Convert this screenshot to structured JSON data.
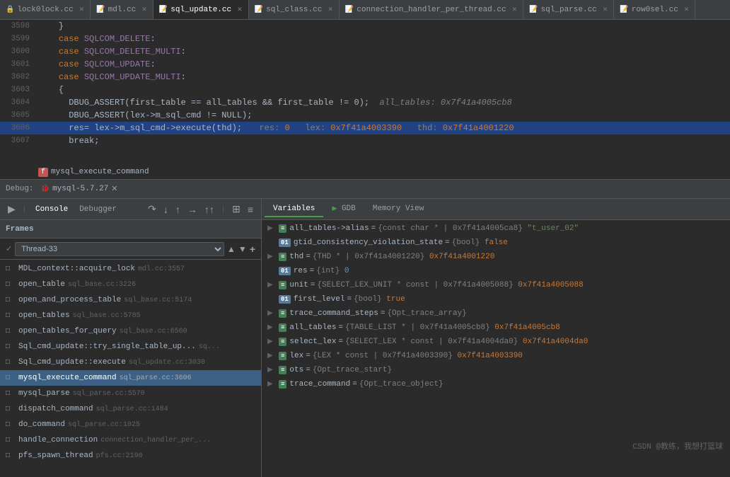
{
  "tabs": [
    {
      "id": "lock0lock",
      "label": "lock0lock.cc",
      "active": false,
      "icon": "📄"
    },
    {
      "id": "mdl",
      "label": "mdl.cc",
      "active": false,
      "icon": "📄"
    },
    {
      "id": "sql_update",
      "label": "sql_update.cc",
      "active": true,
      "icon": "📄"
    },
    {
      "id": "sql_class",
      "label": "sql_class.cc",
      "active": false,
      "icon": "📄"
    },
    {
      "id": "connection_handler",
      "label": "connection_handler_per_thread.cc",
      "active": false,
      "icon": "📄"
    },
    {
      "id": "sql_parse",
      "label": "sql_parse.cc",
      "active": false,
      "icon": "📄"
    },
    {
      "id": "row0sel",
      "label": "row0sel.cc",
      "active": false,
      "icon": "📄"
    }
  ],
  "code_lines": [
    {
      "num": "3598",
      "content": "    }",
      "highlighted": false
    },
    {
      "num": "3599",
      "content": "    case SQLCOM_DELETE:",
      "highlighted": false
    },
    {
      "num": "3600",
      "content": "    case SQLCOM_DELETE_MULTI:",
      "highlighted": false
    },
    {
      "num": "3601",
      "content": "    case SQLCOM_UPDATE:",
      "highlighted": false
    },
    {
      "num": "3602",
      "content": "    case SQLCOM_UPDATE_MULTI:",
      "highlighted": false
    },
    {
      "num": "3603",
      "content": "    {",
      "highlighted": false
    },
    {
      "num": "3604",
      "content": "      DBUG_ASSERT(first_table == all_tables && first_table != 0);",
      "highlighted": false,
      "comment": "all_tables: 0x7f41a4005cb8"
    },
    {
      "num": "3605",
      "content": "      DBUG_ASSERT(lex->m_sql_cmd != NULL);",
      "highlighted": false
    },
    {
      "num": "3606",
      "content": "      res= lex->m_sql_cmd->execute(thd);",
      "highlighted": true,
      "inline": "res: 0   lex: 0x7f41a4003390   thd: 0x7f41a4001220"
    },
    {
      "num": "3607",
      "content": "      break;",
      "highlighted": false
    }
  ],
  "call_tag": "mysql_execute_command",
  "debug_session": "mysql-5.7.27",
  "panel_tabs": {
    "console": "Console",
    "debugger": "Debugger"
  },
  "toolbar_icons": {
    "resume": "▶",
    "pause": "⏸",
    "step_over": "↷",
    "step_into": "↓",
    "step_out": "↑",
    "run_to": "→",
    "settings": "☰",
    "frames_view": "⊞",
    "vars_view": "≡"
  },
  "frames_header": "Frames",
  "thread": {
    "name": "Thread-33",
    "check": "✓"
  },
  "frames": [
    {
      "name": "MDL_context::acquire_lock",
      "loc": "mdl.cc:3557",
      "selected": false,
      "icon": "□"
    },
    {
      "name": "open_table",
      "loc": "sql_base.cc:3226",
      "selected": false,
      "icon": "□"
    },
    {
      "name": "open_and_process_table",
      "loc": "sql_base.cc:5174",
      "selected": false,
      "icon": "□"
    },
    {
      "name": "open_tables",
      "loc": "sql_base.cc:5785",
      "selected": false,
      "icon": "□"
    },
    {
      "name": "open_tables_for_query",
      "loc": "sql_base.cc:6560",
      "selected": false,
      "icon": "□"
    },
    {
      "name": "Sql_cmd_update::try_single_table_update",
      "loc": "sq...",
      "selected": false,
      "icon": "□"
    },
    {
      "name": "Sql_cmd_update::execute",
      "loc": "sql_update.cc:3030",
      "selected": false,
      "icon": "□"
    },
    {
      "name": "mysql_execute_command",
      "loc": "sql_parse.cc:3606",
      "selected": true,
      "icon": "□"
    },
    {
      "name": "mysql_parse",
      "loc": "sql_parse.cc:5570",
      "selected": false,
      "icon": "□"
    },
    {
      "name": "dispatch_command",
      "loc": "sql_parse.cc:1484",
      "selected": false,
      "icon": "□"
    },
    {
      "name": "do_command",
      "loc": "sql_parse.cc:1025",
      "selected": false,
      "icon": "□"
    },
    {
      "name": "handle_connection",
      "loc": "connection_handler_per_...",
      "selected": false,
      "icon": "□"
    },
    {
      "name": "pfs_spawn_thread",
      "loc": "pfs.cc:2190",
      "selected": false,
      "icon": "□"
    }
  ],
  "vars_tabs": [
    {
      "label": "Variables",
      "active": true
    },
    {
      "label": "GDB",
      "icon": "▶",
      "active": false
    },
    {
      "label": "Memory View",
      "active": false
    }
  ],
  "variables": [
    {
      "expand": "▶",
      "type": "e",
      "name": "all_tables->alias",
      "eq": "=",
      "val": "{const char * | 0x7f41a4005ca8}",
      "strval": "\"t_user_02\""
    },
    {
      "expand": " ",
      "type": "01",
      "name": "gtid_consistency_violation_state",
      "eq": "=",
      "val": "{bool}",
      "boolval": "false"
    },
    {
      "expand": "▶",
      "type": "e",
      "name": "thd",
      "eq": "=",
      "val": "{THD * | 0x7f41a4001220}",
      "addrval": "0x7f41a4001220"
    },
    {
      "expand": " ",
      "type": "01",
      "name": "res",
      "eq": "=",
      "val": "{int}",
      "numval": "0"
    },
    {
      "expand": "▶",
      "type": "e",
      "name": "unit",
      "eq": "=",
      "val": "{SELECT_LEX_UNIT * const | 0x7f41a4005088}",
      "addrval": "0x7f41a4005088"
    },
    {
      "expand": " ",
      "type": "01",
      "name": "first_level",
      "eq": "=",
      "val": "{bool}",
      "boolval": "true"
    },
    {
      "expand": "▶",
      "type": "e",
      "name": "trace_command_steps",
      "eq": "=",
      "val": "{Opt_trace_array}"
    },
    {
      "expand": "▶",
      "type": "e",
      "name": "all_tables",
      "eq": "=",
      "val": "{TABLE_LIST * | 0x7f41a4005cb8}",
      "addrval": "0x7f41a4005cb8"
    },
    {
      "expand": "▶",
      "type": "e",
      "name": "select_lex",
      "eq": "=",
      "val": "{SELECT_LEX * const | 0x7f41a4004da0}",
      "addrval": "0x7f41a4004da0"
    },
    {
      "expand": "▶",
      "type": "e",
      "name": "lex",
      "eq": "=",
      "val": "{LEX * const | 0x7f41a4003390}",
      "addrval": "0x7f41a4003390"
    },
    {
      "expand": "▶",
      "type": "e",
      "name": "ots",
      "eq": "=",
      "val": "{Opt_trace_start}"
    },
    {
      "expand": "▶",
      "type": "e",
      "name": "trace_command",
      "eq": "=",
      "val": "{Opt_trace_object}"
    }
  ],
  "watermark": "CSDN @教练，我想打篮球"
}
